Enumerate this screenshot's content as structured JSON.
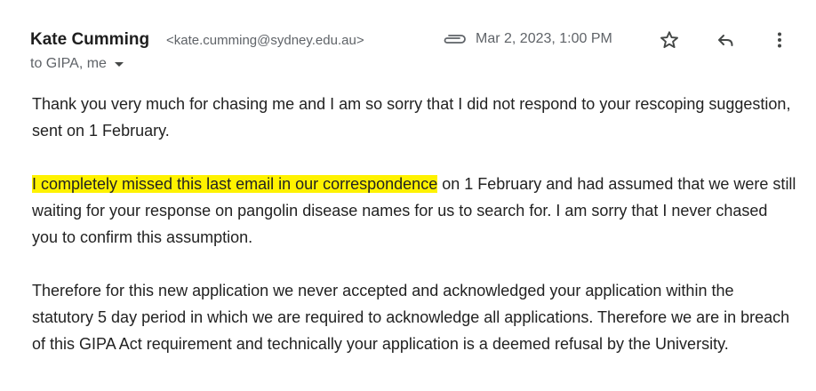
{
  "email": {
    "sender_name": "Kate Cumming",
    "sender_email": "<kate.cumming@sydney.edu.au>",
    "date": "Mar 2, 2023, 1:00 PM",
    "recipients": "to GIPA, me",
    "icons": {
      "attachment": "attachment-icon",
      "star": "star-icon",
      "reply": "reply-icon",
      "more": "more-vert-icon",
      "recipients_toggle": "caret-down-icon"
    }
  },
  "body": {
    "paragraph1": "Thank you very much for chasing me and I am so sorry that I did not respond to your rescoping suggestion, sent on 1 February.",
    "paragraph2_highlight": "I completely missed this last email in our correspondence",
    "paragraph2_rest": " on 1 February and had assumed that we were still waiting for your response on pangolin disease names for us to search for. I am sorry that I never chased you to confirm this assumption.",
    "paragraph3": "Therefore for this new application we never accepted and acknowledged your application within the statutory 5 day period in which we are required to acknowledge all applications. Therefore we are in breach of this GIPA Act requirement and technically your application is a deemed refusal by the University."
  },
  "colors": {
    "highlight": "#fff200",
    "muted_text": "#5f6368",
    "body_text": "#222222"
  }
}
